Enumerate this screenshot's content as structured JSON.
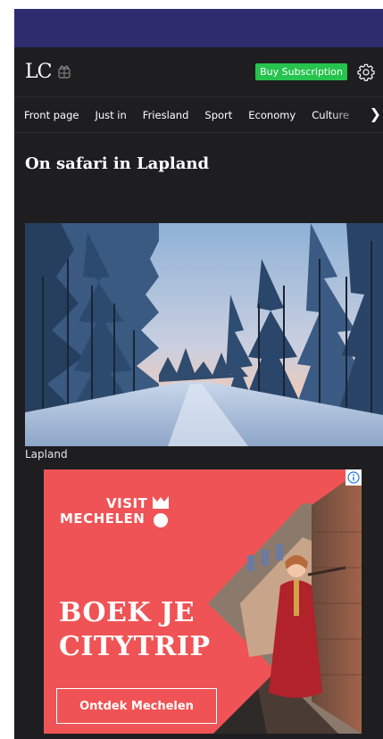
{
  "header": {
    "logo_text": "LC",
    "subscribe_label": "Buy Subscription"
  },
  "nav": {
    "items": [
      {
        "label": "Front page"
      },
      {
        "label": "Just in"
      },
      {
        "label": "Friesland"
      },
      {
        "label": "Sport"
      },
      {
        "label": "Economy"
      },
      {
        "label": "Culture"
      }
    ],
    "more_icon": "chevron-right-icon"
  },
  "article": {
    "headline": "On safari in Lapland",
    "image_caption": "Lapland"
  },
  "ad": {
    "brand_line1": "VISIT",
    "brand_line2": "MECHELEN",
    "headline_line1": "BOEK JE",
    "headline_line2": "CITYTRIP",
    "cta_label": "Ontdek Mechelen",
    "info_icon": "info-icon"
  },
  "colors": {
    "status_bar": "#2e2d70",
    "background": "#1e1e20",
    "subscribe": "#26c34e",
    "ad_background": "#f05355"
  }
}
